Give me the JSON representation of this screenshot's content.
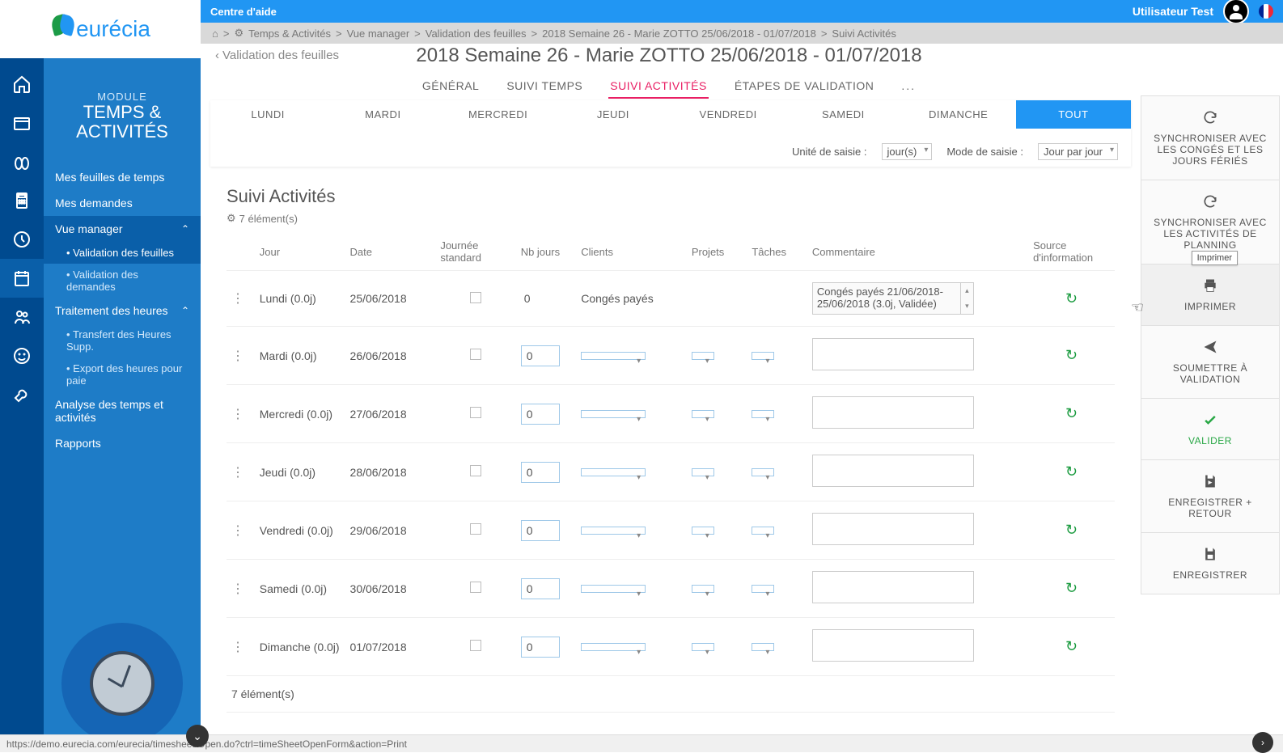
{
  "topbar": {
    "help": "Centre d'aide",
    "user": "Utilisateur  Test"
  },
  "breadcrumb": [
    "Temps & Activités",
    "Vue manager",
    "Validation des feuilles",
    "2018 Semaine 26 - Marie ZOTTO 25/06/2018 - 01/07/2018",
    "Suivi Activités"
  ],
  "logo": "eurécia",
  "module": {
    "label": "MODULE",
    "title_line1": "TEMPS &",
    "title_line2": "ACTIVITÉS"
  },
  "sidebar": {
    "items": [
      {
        "label": "Mes feuilles de temps"
      },
      {
        "label": "Mes demandes"
      },
      {
        "label": "Vue manager",
        "expanded": true,
        "subs": [
          {
            "label": "Validation des feuilles",
            "active": true
          },
          {
            "label": "Validation des demandes"
          }
        ]
      },
      {
        "label": "Traitement des heures",
        "expanded": true,
        "subs": [
          {
            "label": "Transfert des Heures Supp."
          },
          {
            "label": "Export des heures pour paie"
          }
        ]
      },
      {
        "label": "Analyse des temps et activités"
      },
      {
        "label": "Rapports"
      }
    ]
  },
  "back_link": "Validation des feuilles",
  "page_title": "2018 Semaine 26 - Marie ZOTTO 25/06/2018 - 01/07/2018",
  "subtabs": [
    "GÉNÉRAL",
    "SUIVI TEMPS",
    "SUIVI ACTIVITÉS",
    "ÉTAPES DE VALIDATION",
    "..."
  ],
  "subtabs_active": 2,
  "daytabs": [
    "LUNDI",
    "MARDI",
    "MERCREDI",
    "JEUDI",
    "VENDREDI",
    "SAMEDI",
    "DIMANCHE",
    "TOUT"
  ],
  "daytabs_active": 7,
  "filters": {
    "unit_label": "Unité de saisie :",
    "unit_value": "jour(s)",
    "mode_label": "Mode de saisie :",
    "mode_value": "Jour par jour"
  },
  "section": {
    "title": "Suivi Activités",
    "count": "7 élément(s)",
    "columns": [
      "Jour",
      "Date",
      "Journée standard",
      "Nb jours",
      "Clients",
      "Projets",
      "Tâches",
      "Commentaire",
      "Source d'information"
    ],
    "rows": [
      {
        "day": "Lundi (0.0j)",
        "date": "25/06/2018",
        "nb": "0",
        "client_text": "Congés payés",
        "comment": "Congés payés 21/06/2018-25/06/2018 (3.0j, Validée)",
        "readonly": true
      },
      {
        "day": "Mardi (0.0j)",
        "date": "26/06/2018",
        "nb": "0"
      },
      {
        "day": "Mercredi (0.0j)",
        "date": "27/06/2018",
        "nb": "0"
      },
      {
        "day": "Jeudi (0.0j)",
        "date": "28/06/2018",
        "nb": "0"
      },
      {
        "day": "Vendredi (0.0j)",
        "date": "29/06/2018",
        "nb": "0"
      },
      {
        "day": "Samedi (0.0j)",
        "date": "30/06/2018",
        "nb": "0"
      },
      {
        "day": "Dimanche (0.0j)",
        "date": "01/07/2018",
        "nb": "0"
      }
    ],
    "footer": "7 élément(s)"
  },
  "actions": [
    {
      "label": "SYNCHRONISER AVEC LES CONGÉS ET LES JOURS FÉRIÉS",
      "icon": "sync"
    },
    {
      "label": "SYNCHRONISER AVEC LES ACTIVITÉS DE PLANNING",
      "icon": "sync"
    },
    {
      "label": "IMPRIMER",
      "icon": "print",
      "hover": true
    },
    {
      "label": "SOUMETTRE À VALIDATION",
      "icon": "send"
    },
    {
      "label": "VALIDER",
      "icon": "check",
      "validate": true
    },
    {
      "label": "ENREGISTRER + RETOUR",
      "icon": "save-return"
    },
    {
      "label": "ENREGISTRER",
      "icon": "save"
    }
  ],
  "tooltip": "Imprimer",
  "statusbar": "https://demo.eurecia.com/eurecia/timesheet/Open.do?ctrl=timeSheetOpenForm&action=Print"
}
